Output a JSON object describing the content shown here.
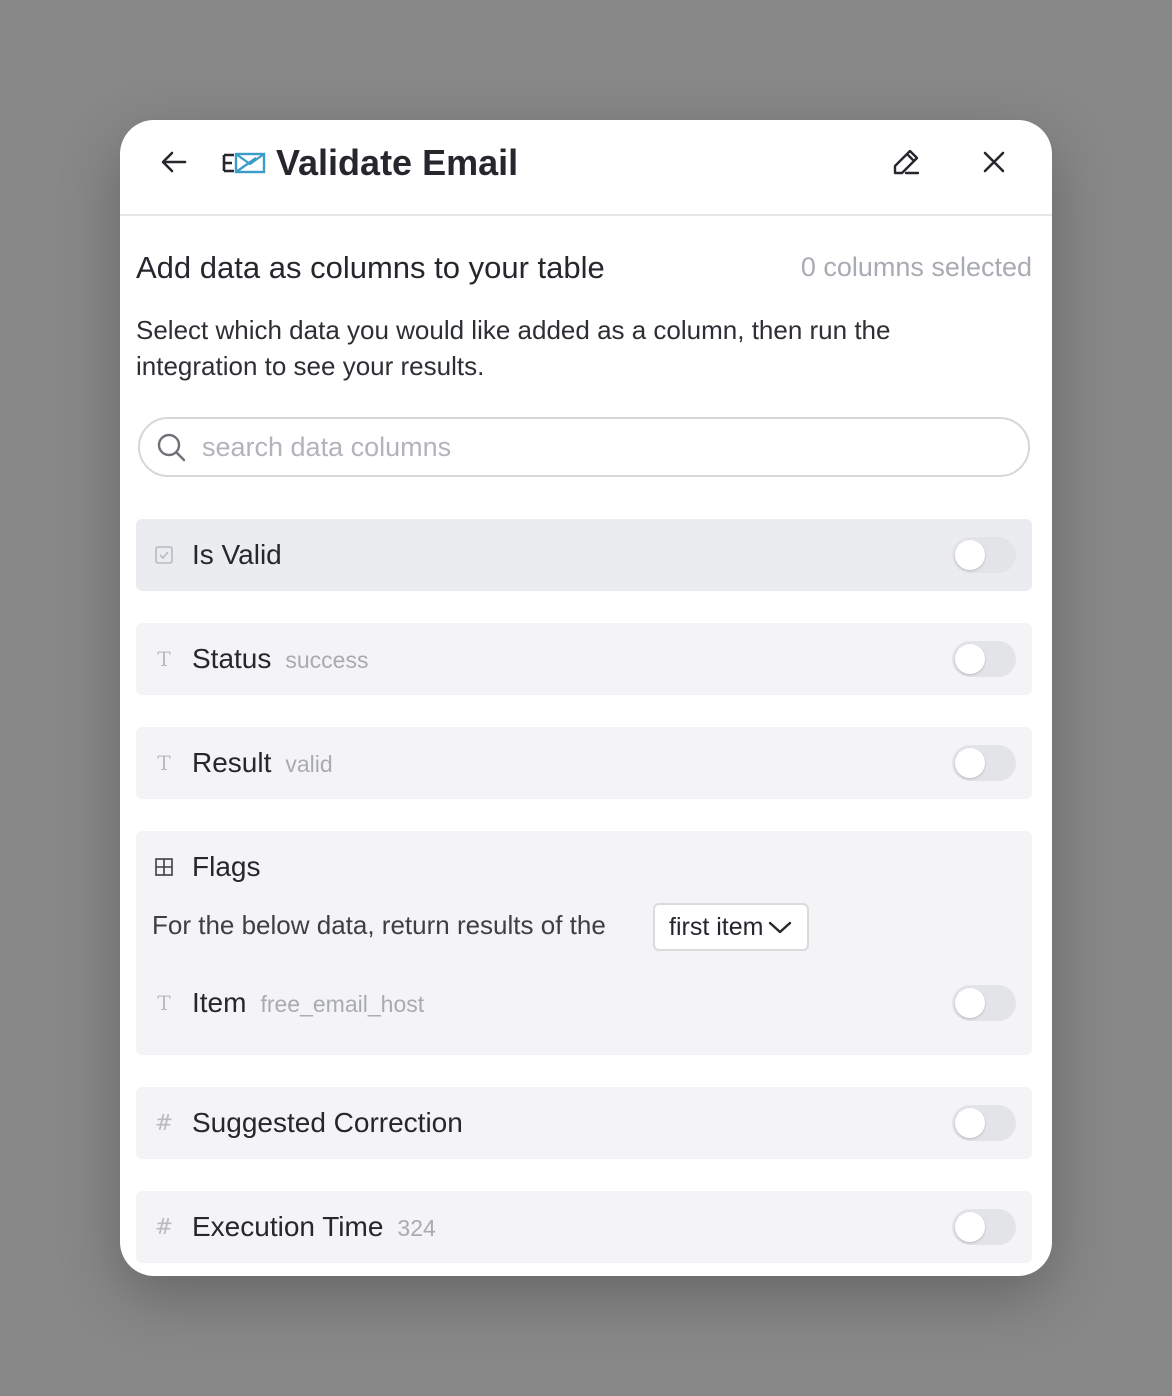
{
  "header": {
    "title": "Validate Email",
    "back_icon": "arrow-left-icon",
    "edit_icon": "pencil-icon",
    "close_icon": "close-icon",
    "brand_colors": {
      "text": "#25272c",
      "accent": "#3a9cc9"
    }
  },
  "section": {
    "title": "Add data as columns to your table",
    "selected_count": "0 columns selected",
    "description": "Select which data you would like added as a column, then run the integration to see your results."
  },
  "search": {
    "placeholder": "search data columns",
    "value": ""
  },
  "columns": [
    {
      "label": "Is Valid",
      "sample": "",
      "type_icon": "checkbox-icon",
      "enabled": false
    },
    {
      "label": "Status",
      "sample": "success",
      "type_icon": "text-type-icon",
      "enabled": false
    },
    {
      "label": "Result",
      "sample": "valid",
      "type_icon": "text-type-icon",
      "enabled": false
    }
  ],
  "flags": {
    "label": "Flags",
    "type_icon": "table-icon",
    "return_text": "For the below data, return results of the",
    "dropdown_value": "first item",
    "item": {
      "label": "Item",
      "sample": "free_email_host",
      "type_icon": "text-type-icon",
      "enabled": false
    }
  },
  "more_columns": [
    {
      "label": "Suggested Correction",
      "sample": "",
      "type_icon": "number-type-icon",
      "enabled": false
    },
    {
      "label": "Execution Time",
      "sample": "324",
      "type_icon": "number-type-icon",
      "enabled": false
    }
  ]
}
